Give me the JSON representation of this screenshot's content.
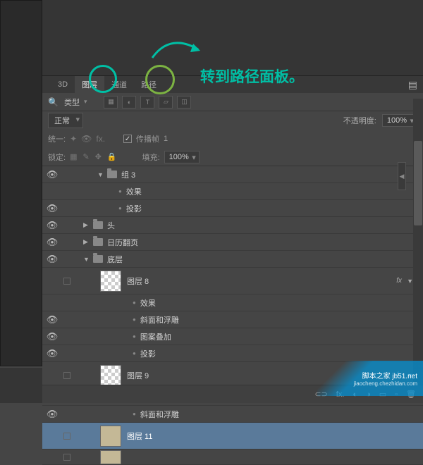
{
  "tabs": {
    "t3d": "3D",
    "layers": "图层",
    "channels": "通道",
    "paths": "路径"
  },
  "annotation": {
    "text": "转到路径面板。"
  },
  "toolbar": {
    "filter_label": "类型"
  },
  "blend": {
    "mode": "正常",
    "opacity_label": "不透明度:",
    "opacity_value": "100%"
  },
  "unity": {
    "label": "统一:",
    "propagate_label": "传播帧",
    "propagate_value": "1"
  },
  "lock": {
    "label": "锁定:",
    "fill_label": "填充:",
    "fill_value": "100%"
  },
  "layers_tree": {
    "group3": "组 3",
    "effects": "效果",
    "drop_shadow": "投影",
    "head": "头",
    "calendar": "日历翻页",
    "bottom_layer": "底层",
    "layer8": "图层 8",
    "bevel": "斜面和浮雕",
    "pattern": "图案叠加",
    "layer9": "图层 9",
    "layer11": "图层 11"
  },
  "fx": {
    "badge": "fx"
  },
  "bottom": {
    "link": "⊂⊃",
    "fx": "fx.",
    "mask": "◐",
    "adjust": "◑",
    "folder": "▭",
    "new": "▫",
    "trash": "🗑"
  },
  "watermark": {
    "line1": "脚本之家 jb51.net",
    "line2": "jiaocheng.chezhidan.com"
  }
}
